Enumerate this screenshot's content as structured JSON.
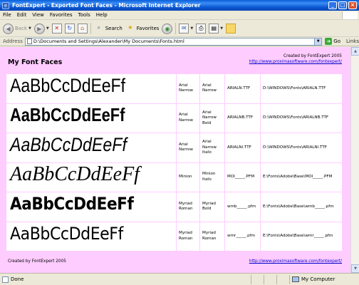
{
  "window": {
    "title": "FontExpert - Exported Font Faces - Microsoft Internet Explorer",
    "minimize": "_",
    "maximize": "□",
    "close": "×"
  },
  "menu": [
    "File",
    "Edit",
    "View",
    "Favorites",
    "Tools",
    "Help"
  ],
  "toolbar": {
    "back_label": "Back",
    "search_label": "Search",
    "favorites_label": "Favorites"
  },
  "address": {
    "label": "Address",
    "url": "D:\\Documents and Settings\\Alexander\\My Documents\\Fonts.html",
    "go_label": "Go",
    "links_label": "Links"
  },
  "page": {
    "title": "My Font Faces",
    "created_by": "Created by FontExpert 2005",
    "site_url": "http://www.proximasoftware.com/fontexpert/",
    "footer_created_by": "Created by FontExpert 2005",
    "footer_url": "http://www.proximasoftware.com/fontexpert/"
  },
  "fonts": [
    {
      "sample": "AaBbCcDdEeFf",
      "name": "Arial Narrow",
      "style": "Arial Narrow",
      "file": "ARIALN.TTF",
      "path": "D:\\WINDOWS\\Fonts\\ARIALN.TTF"
    },
    {
      "sample": "AaBbCcDdEeFf",
      "name": "Arial Narrow",
      "style": "Arial Narrow Bold",
      "file": "ARIALNB.TTF",
      "path": "D:\\WINDOWS\\Fonts\\ARIALNB.TTF"
    },
    {
      "sample": "AaBbCcDdEeFf",
      "name": "Arial Narrow",
      "style": "Arial Narrow Italic",
      "file": "ARIALNI.TTF",
      "path": "D:\\WINDOWS\\Fonts\\ARIALNI.TTF"
    },
    {
      "sample": "AaBbCcDdEeFf",
      "name": "Minion",
      "style": "Minion Italic",
      "file": "MOI_____.PFM",
      "path": "E:\\Fonts\\Adobe\\Base\\MOI_____.PFM"
    },
    {
      "sample": "AaBbCcDdEeFf",
      "name": "Myriad Roman",
      "style": "Myriad Bold",
      "file": "wmb_____.pfm",
      "path": "E:\\Fonts\\Adobe\\Base\\wmb_____.pfm"
    },
    {
      "sample": "AaBbCcDdEeFf",
      "name": "Myriad Roman",
      "style": "Myriad Roman",
      "file": "wmr_____.pfm",
      "path": "E:\\Fonts\\Adobe\\Base\\wmr_____.pfm"
    }
  ],
  "status": {
    "text": "Done",
    "zone": "My Computer"
  },
  "colors": {
    "page_background": "#FFCCFF",
    "link": "#0000CC",
    "titlebar": "#0A5FD8"
  },
  "icons": [
    "ie-icon",
    "back-arrow-icon",
    "forward-arrow-icon",
    "stop-icon",
    "refresh-icon",
    "home-icon",
    "search-icon",
    "favorites-star-icon",
    "media-icon",
    "mail-icon",
    "print-icon",
    "edit-icon",
    "folder-icon",
    "go-arrow-icon",
    "my-computer-icon"
  ]
}
